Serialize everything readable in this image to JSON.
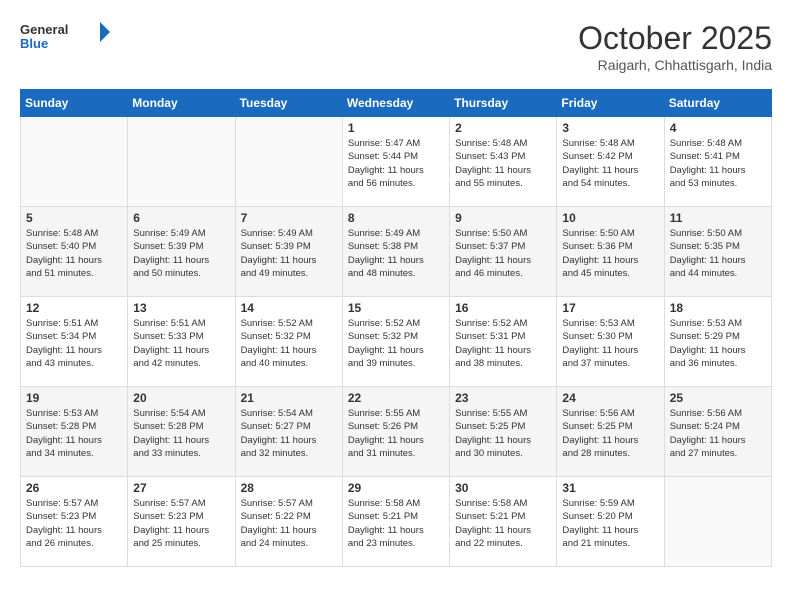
{
  "header": {
    "logo_line1": "General",
    "logo_line2": "Blue",
    "month_title": "October 2025",
    "location": "Raigarh, Chhattisgarh, India"
  },
  "weekdays": [
    "Sunday",
    "Monday",
    "Tuesday",
    "Wednesday",
    "Thursday",
    "Friday",
    "Saturday"
  ],
  "weeks": [
    [
      {
        "day": "",
        "info": ""
      },
      {
        "day": "",
        "info": ""
      },
      {
        "day": "",
        "info": ""
      },
      {
        "day": "1",
        "info": "Sunrise: 5:47 AM\nSunset: 5:44 PM\nDaylight: 11 hours\nand 56 minutes."
      },
      {
        "day": "2",
        "info": "Sunrise: 5:48 AM\nSunset: 5:43 PM\nDaylight: 11 hours\nand 55 minutes."
      },
      {
        "day": "3",
        "info": "Sunrise: 5:48 AM\nSunset: 5:42 PM\nDaylight: 11 hours\nand 54 minutes."
      },
      {
        "day": "4",
        "info": "Sunrise: 5:48 AM\nSunset: 5:41 PM\nDaylight: 11 hours\nand 53 minutes."
      }
    ],
    [
      {
        "day": "5",
        "info": "Sunrise: 5:48 AM\nSunset: 5:40 PM\nDaylight: 11 hours\nand 51 minutes."
      },
      {
        "day": "6",
        "info": "Sunrise: 5:49 AM\nSunset: 5:39 PM\nDaylight: 11 hours\nand 50 minutes."
      },
      {
        "day": "7",
        "info": "Sunrise: 5:49 AM\nSunset: 5:39 PM\nDaylight: 11 hours\nand 49 minutes."
      },
      {
        "day": "8",
        "info": "Sunrise: 5:49 AM\nSunset: 5:38 PM\nDaylight: 11 hours\nand 48 minutes."
      },
      {
        "day": "9",
        "info": "Sunrise: 5:50 AM\nSunset: 5:37 PM\nDaylight: 11 hours\nand 46 minutes."
      },
      {
        "day": "10",
        "info": "Sunrise: 5:50 AM\nSunset: 5:36 PM\nDaylight: 11 hours\nand 45 minutes."
      },
      {
        "day": "11",
        "info": "Sunrise: 5:50 AM\nSunset: 5:35 PM\nDaylight: 11 hours\nand 44 minutes."
      }
    ],
    [
      {
        "day": "12",
        "info": "Sunrise: 5:51 AM\nSunset: 5:34 PM\nDaylight: 11 hours\nand 43 minutes."
      },
      {
        "day": "13",
        "info": "Sunrise: 5:51 AM\nSunset: 5:33 PM\nDaylight: 11 hours\nand 42 minutes."
      },
      {
        "day": "14",
        "info": "Sunrise: 5:52 AM\nSunset: 5:32 PM\nDaylight: 11 hours\nand 40 minutes."
      },
      {
        "day": "15",
        "info": "Sunrise: 5:52 AM\nSunset: 5:32 PM\nDaylight: 11 hours\nand 39 minutes."
      },
      {
        "day": "16",
        "info": "Sunrise: 5:52 AM\nSunset: 5:31 PM\nDaylight: 11 hours\nand 38 minutes."
      },
      {
        "day": "17",
        "info": "Sunrise: 5:53 AM\nSunset: 5:30 PM\nDaylight: 11 hours\nand 37 minutes."
      },
      {
        "day": "18",
        "info": "Sunrise: 5:53 AM\nSunset: 5:29 PM\nDaylight: 11 hours\nand 36 minutes."
      }
    ],
    [
      {
        "day": "19",
        "info": "Sunrise: 5:53 AM\nSunset: 5:28 PM\nDaylight: 11 hours\nand 34 minutes."
      },
      {
        "day": "20",
        "info": "Sunrise: 5:54 AM\nSunset: 5:28 PM\nDaylight: 11 hours\nand 33 minutes."
      },
      {
        "day": "21",
        "info": "Sunrise: 5:54 AM\nSunset: 5:27 PM\nDaylight: 11 hours\nand 32 minutes."
      },
      {
        "day": "22",
        "info": "Sunrise: 5:55 AM\nSunset: 5:26 PM\nDaylight: 11 hours\nand 31 minutes."
      },
      {
        "day": "23",
        "info": "Sunrise: 5:55 AM\nSunset: 5:25 PM\nDaylight: 11 hours\nand 30 minutes."
      },
      {
        "day": "24",
        "info": "Sunrise: 5:56 AM\nSunset: 5:25 PM\nDaylight: 11 hours\nand 28 minutes."
      },
      {
        "day": "25",
        "info": "Sunrise: 5:56 AM\nSunset: 5:24 PM\nDaylight: 11 hours\nand 27 minutes."
      }
    ],
    [
      {
        "day": "26",
        "info": "Sunrise: 5:57 AM\nSunset: 5:23 PM\nDaylight: 11 hours\nand 26 minutes."
      },
      {
        "day": "27",
        "info": "Sunrise: 5:57 AM\nSunset: 5:23 PM\nDaylight: 11 hours\nand 25 minutes."
      },
      {
        "day": "28",
        "info": "Sunrise: 5:57 AM\nSunset: 5:22 PM\nDaylight: 11 hours\nand 24 minutes."
      },
      {
        "day": "29",
        "info": "Sunrise: 5:58 AM\nSunset: 5:21 PM\nDaylight: 11 hours\nand 23 minutes."
      },
      {
        "day": "30",
        "info": "Sunrise: 5:58 AM\nSunset: 5:21 PM\nDaylight: 11 hours\nand 22 minutes."
      },
      {
        "day": "31",
        "info": "Sunrise: 5:59 AM\nSunset: 5:20 PM\nDaylight: 11 hours\nand 21 minutes."
      },
      {
        "day": "",
        "info": ""
      }
    ]
  ]
}
